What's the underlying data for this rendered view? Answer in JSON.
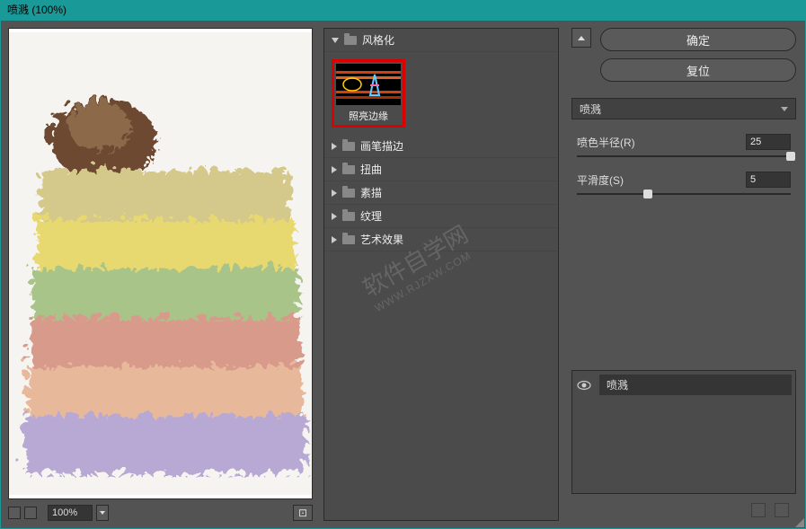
{
  "titlebar": {
    "title": "喷溅 (100%)"
  },
  "preview": {
    "zoom": "100%"
  },
  "tree": {
    "categories": [
      {
        "label": "风格化",
        "expanded": true
      },
      {
        "label": "画笔描边",
        "expanded": false
      },
      {
        "label": "扭曲",
        "expanded": false
      },
      {
        "label": "素描",
        "expanded": false
      },
      {
        "label": "纹理",
        "expanded": false
      },
      {
        "label": "艺术效果",
        "expanded": false
      }
    ],
    "selected_thumb": {
      "label": "照亮边缘"
    }
  },
  "actions": {
    "ok": "确定",
    "reset": "复位"
  },
  "filter_dropdown": {
    "selected": "喷溅"
  },
  "params": {
    "radius": {
      "label": "喷色半径(R)",
      "value": "25",
      "percent": 100
    },
    "smooth": {
      "label": "平滑度(S)",
      "value": "5",
      "percent": 33
    }
  },
  "effects": {
    "items": [
      {
        "name": "喷溅",
        "visible": true
      }
    ]
  },
  "watermark": {
    "text": "软件自学网",
    "url": "WWW.RJZXW.COM"
  }
}
